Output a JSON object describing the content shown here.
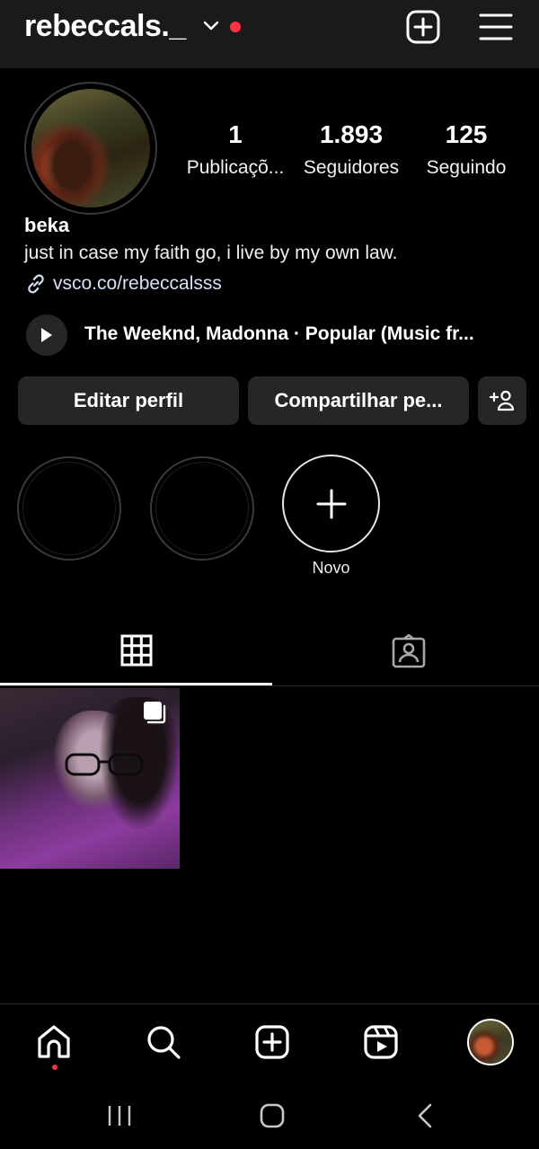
{
  "header": {
    "username": "rebeccals._",
    "icons": [
      "chevron-down-icon",
      "notification-dot",
      "add-square-icon",
      "menu-icon"
    ],
    "accent_color": "#ff3040"
  },
  "profile": {
    "stats": [
      {
        "value": "1",
        "label": "Publicaçõ..."
      },
      {
        "value": "1.893",
        "label": "Seguidores"
      },
      {
        "value": "125",
        "label": "Seguindo"
      }
    ],
    "name": "beka",
    "bio": "just in case my faith go, i live by my own law.",
    "link": "vsco.co/rebeccalsss",
    "music": "The Weeknd, Madonna · Popular (Music fr..."
  },
  "actions": {
    "edit_label": "Editar perfil",
    "share_label": "Compartilhar pe..."
  },
  "highlights": {
    "new_label": "Novo"
  },
  "tabs": {
    "items": [
      "grid-icon",
      "tagged-icon"
    ],
    "active": "grid-icon"
  },
  "posts": [
    {
      "type": "carousel",
      "icon": "multiple-photos-icon"
    }
  ],
  "bottom_nav": {
    "items": [
      "home-icon",
      "search-icon",
      "create-icon",
      "reels-icon",
      "profile-avatar"
    ],
    "active": "profile-avatar"
  },
  "system_nav": {
    "items": [
      "recents-icon",
      "home-icon",
      "back-icon"
    ]
  }
}
